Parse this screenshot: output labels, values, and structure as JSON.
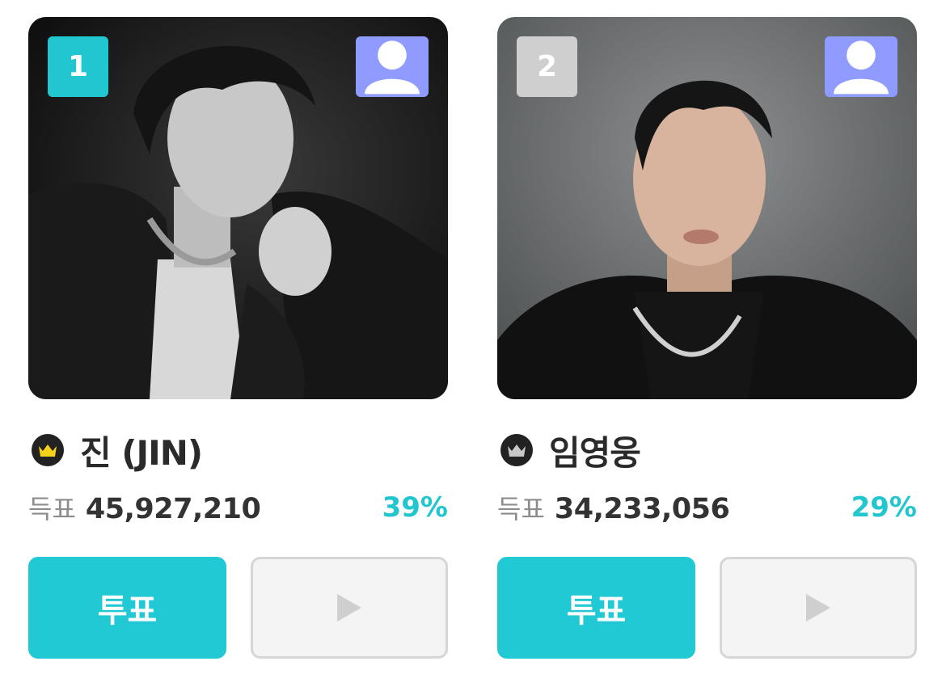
{
  "colors": {
    "accent": "#20c9d4",
    "rank_first": "#22c6d0",
    "rank_second": "#cfcfcf",
    "profile_button": "#8f9bff",
    "percent_text": "#21c6cf",
    "crown_gold": "#f6d21b",
    "crown_silver": "#c9c9c9"
  },
  "candidates": [
    {
      "rank": "1",
      "crown_icon": "gold-crown-icon",
      "name": "진 (JIN)",
      "votes_label": "득표",
      "votes": "45,927,210",
      "percent": "39%",
      "vote_label": "투표",
      "play_icon": "play-icon",
      "profile_icon": "person-icon"
    },
    {
      "rank": "2",
      "crown_icon": "silver-crown-icon",
      "name": "임영웅",
      "votes_label": "득표",
      "votes": "34,233,056",
      "percent": "29%",
      "vote_label": "투표",
      "play_icon": "play-icon",
      "profile_icon": "person-icon"
    }
  ]
}
